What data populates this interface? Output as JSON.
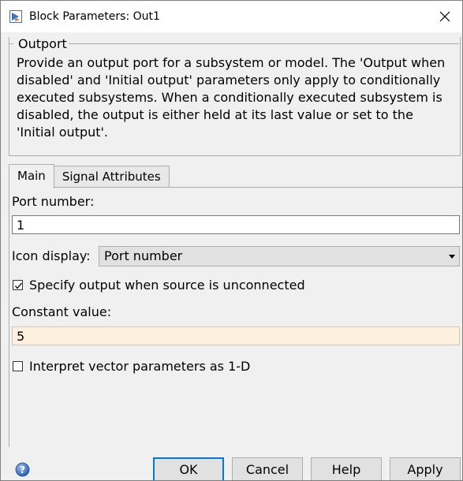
{
  "window": {
    "title": "Block Parameters: Out1",
    "close_glyph": "✕"
  },
  "block": {
    "type": "Outport",
    "description": "Provide an output port for a subsystem or model.  The 'Output when disabled' and 'Initial output' parameters only apply to conditionally executed subsystems. When a conditionally executed subsystem is disabled, the output is either held at its last value or set to the 'Initial output'."
  },
  "tabs": [
    {
      "label": "Main",
      "active": true
    },
    {
      "label": "Signal Attributes",
      "active": false
    }
  ],
  "main": {
    "port_number_label": "Port number:",
    "port_number_value": "1",
    "icon_display_label": "Icon display:",
    "icon_display_value": "Port number",
    "specify_output_label": "Specify output when source is unconnected",
    "specify_output_checked": true,
    "constant_value_label": "Constant value:",
    "constant_value_value": "5",
    "interpret_vector_label": "Interpret vector parameters as 1-D",
    "interpret_vector_checked": false
  },
  "footer": {
    "ok_label": "OK",
    "cancel_label": "Cancel",
    "help_label": "Help",
    "apply_label": "Apply",
    "help_icon": "help-icon"
  },
  "colors": {
    "accent": "#0078d7",
    "highlight_field": "#fdf0dc",
    "help_icon_blue": "#3a6fc4"
  }
}
